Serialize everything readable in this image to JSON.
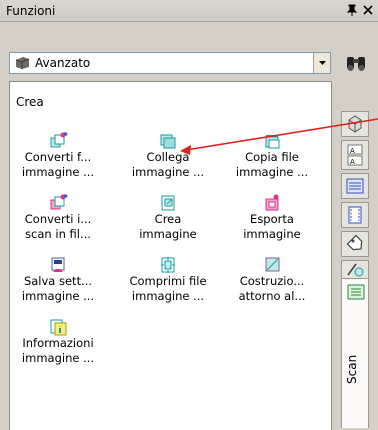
{
  "panel": {
    "title": "Funzioni"
  },
  "combo": {
    "selected": "Avanzato"
  },
  "section": {
    "title": "Crea"
  },
  "items": [
    {
      "line1": "Converti f...",
      "line2": "immagine ...",
      "icon": "convert-image-icon"
    },
    {
      "line1": "Collega",
      "line2": "immagine ...",
      "icon": "link-image-icon"
    },
    {
      "line1": "Copia file",
      "line2": "immagine ...",
      "icon": "copy-file-icon"
    },
    {
      "line1": "Converti i...",
      "line2": "scan in fil...",
      "icon": "convert-scan-icon"
    },
    {
      "line1": "Crea",
      "line2": "immagine",
      "icon": "create-image-icon"
    },
    {
      "line1": "Esporta",
      "line2": "immagine",
      "icon": "export-image-icon"
    },
    {
      "line1": "Salva sett...",
      "line2": "immagine ...",
      "icon": "save-settings-icon"
    },
    {
      "line1": "Comprimi file",
      "line2": "immagine ...",
      "icon": "compress-file-icon"
    },
    {
      "line1": "Costruzio...",
      "line2": "attorno al...",
      "icon": "build-around-icon"
    },
    {
      "line1": "Informazioni",
      "line2": "immagine ...",
      "icon": "image-info-icon"
    }
  ],
  "sidebar": {
    "scan_label": "Scan"
  },
  "colors": {
    "accent_red": "#e0201c",
    "icon_teal": "#1a9b9b",
    "icon_pink": "#e0308a"
  }
}
